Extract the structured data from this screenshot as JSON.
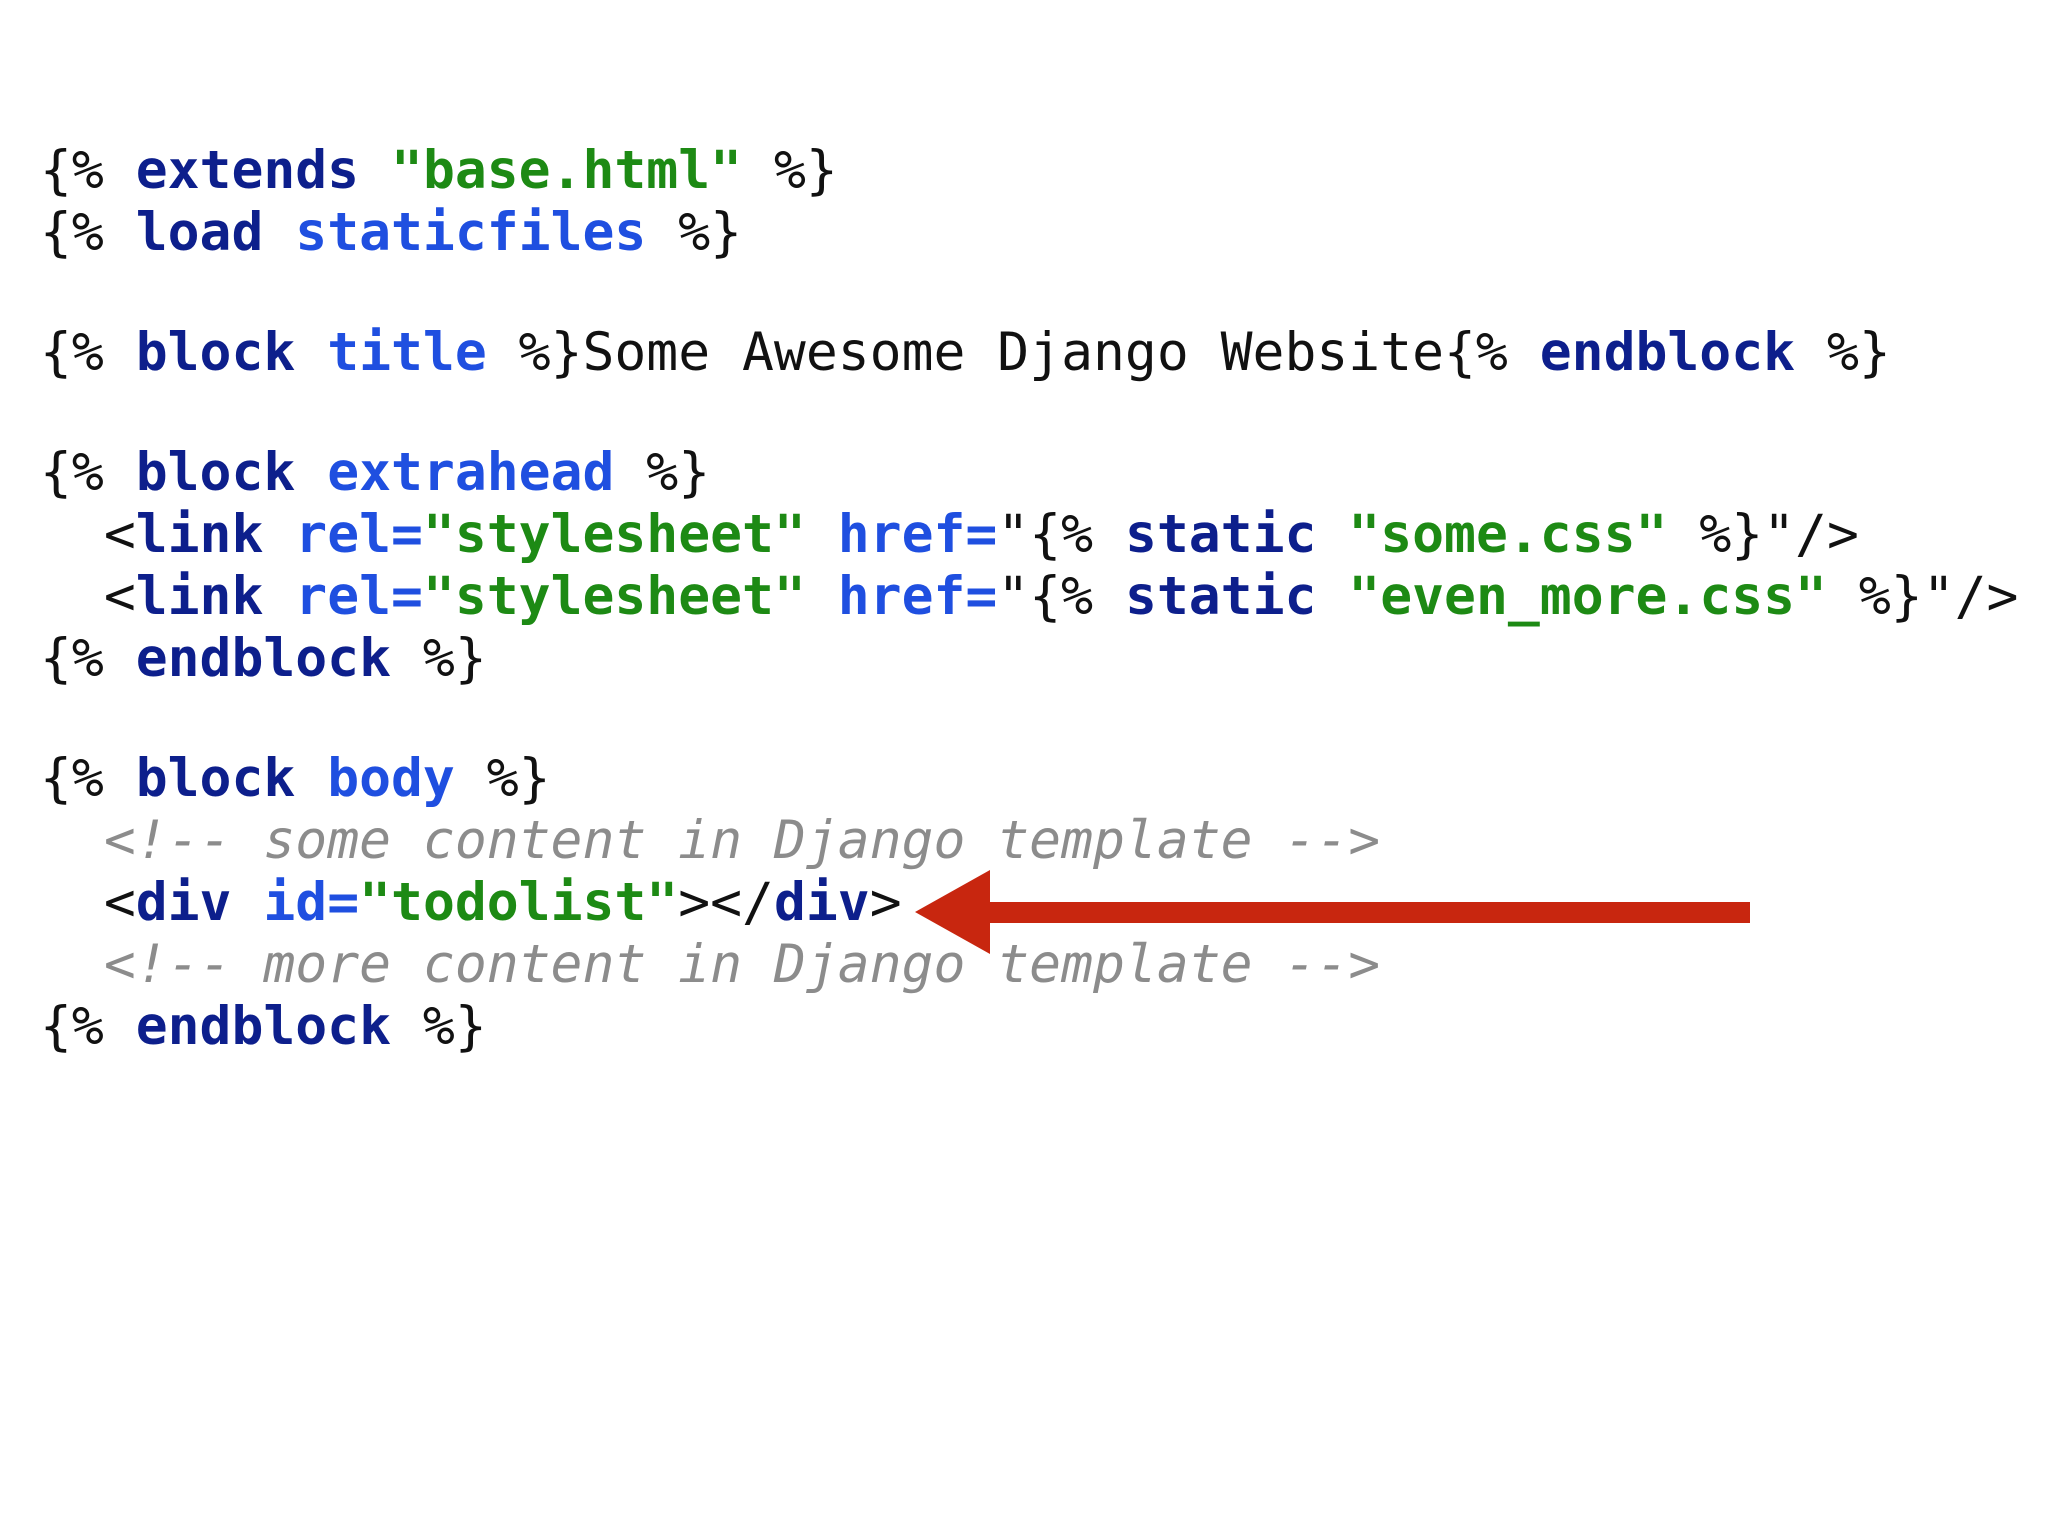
{
  "colors": {
    "background": "#ffffff",
    "plain": "#111111",
    "keyword": "#0d1f8c",
    "name": "#1f4fe0",
    "string": "#1d8a14",
    "comment": "#8c8c8c",
    "arrow": "#c8260f"
  },
  "code_lines": [
    [
      {
        "t": "{% ",
        "c": "plain"
      },
      {
        "t": "extends",
        "c": "kw"
      },
      {
        "t": " ",
        "c": "plain"
      },
      {
        "t": "\"base.html\"",
        "c": "str"
      },
      {
        "t": " %}",
        "c": "plain"
      }
    ],
    [
      {
        "t": "{% ",
        "c": "plain"
      },
      {
        "t": "load",
        "c": "kw"
      },
      {
        "t": " ",
        "c": "plain"
      },
      {
        "t": "staticfiles",
        "c": "name"
      },
      {
        "t": " %}",
        "c": "plain"
      }
    ],
    [],
    [
      {
        "t": "{% ",
        "c": "plain"
      },
      {
        "t": "block",
        "c": "kw"
      },
      {
        "t": " ",
        "c": "plain"
      },
      {
        "t": "title",
        "c": "name"
      },
      {
        "t": " %}Some Awesome Django Website{% ",
        "c": "plain"
      },
      {
        "t": "endblock",
        "c": "kw"
      },
      {
        "t": " %}",
        "c": "plain"
      }
    ],
    [],
    [
      {
        "t": "{% ",
        "c": "plain"
      },
      {
        "t": "block",
        "c": "kw"
      },
      {
        "t": " ",
        "c": "plain"
      },
      {
        "t": "extrahead",
        "c": "name"
      },
      {
        "t": " %}",
        "c": "plain"
      }
    ],
    [
      {
        "t": "  <",
        "c": "plain"
      },
      {
        "t": "link",
        "c": "kw"
      },
      {
        "t": " ",
        "c": "plain"
      },
      {
        "t": "rel=",
        "c": "name"
      },
      {
        "t": "\"stylesheet\"",
        "c": "str"
      },
      {
        "t": " ",
        "c": "plain"
      },
      {
        "t": "href=",
        "c": "name"
      },
      {
        "t": "\"{% ",
        "c": "plain"
      },
      {
        "t": "static",
        "c": "kw"
      },
      {
        "t": " ",
        "c": "plain"
      },
      {
        "t": "\"some.css\"",
        "c": "str"
      },
      {
        "t": " %}\"/>",
        "c": "plain"
      }
    ],
    [
      {
        "t": "  <",
        "c": "plain"
      },
      {
        "t": "link",
        "c": "kw"
      },
      {
        "t": " ",
        "c": "plain"
      },
      {
        "t": "rel=",
        "c": "name"
      },
      {
        "t": "\"stylesheet\"",
        "c": "str"
      },
      {
        "t": " ",
        "c": "plain"
      },
      {
        "t": "href=",
        "c": "name"
      },
      {
        "t": "\"{% ",
        "c": "plain"
      },
      {
        "t": "static",
        "c": "kw"
      },
      {
        "t": " ",
        "c": "plain"
      },
      {
        "t": "\"even_more.css\"",
        "c": "str"
      },
      {
        "t": " %}\"/>",
        "c": "plain"
      }
    ],
    [
      {
        "t": "{% ",
        "c": "plain"
      },
      {
        "t": "endblock",
        "c": "kw"
      },
      {
        "t": " %}",
        "c": "plain"
      }
    ],
    [],
    [
      {
        "t": "{% ",
        "c": "plain"
      },
      {
        "t": "block",
        "c": "kw"
      },
      {
        "t": " ",
        "c": "plain"
      },
      {
        "t": "body",
        "c": "name"
      },
      {
        "t": " %}",
        "c": "plain"
      }
    ],
    [
      {
        "t": "  ",
        "c": "plain"
      },
      {
        "t": "<!-- some content in Django template -->",
        "c": "cmt"
      }
    ],
    [
      {
        "t": "  <",
        "c": "plain"
      },
      {
        "t": "div",
        "c": "kw"
      },
      {
        "t": " ",
        "c": "plain"
      },
      {
        "t": "id=",
        "c": "name"
      },
      {
        "t": "\"todolist\"",
        "c": "str"
      },
      {
        "t": "></",
        "c": "plain"
      },
      {
        "t": "div",
        "c": "kw"
      },
      {
        "t": ">",
        "c": "plain"
      }
    ],
    [
      {
        "t": "  ",
        "c": "plain"
      },
      {
        "t": "<!-- more content in Django template -->",
        "c": "cmt"
      }
    ],
    [
      {
        "t": "{% ",
        "c": "plain"
      },
      {
        "t": "endblock",
        "c": "kw"
      },
      {
        "t": " %}",
        "c": "plain"
      }
    ]
  ]
}
